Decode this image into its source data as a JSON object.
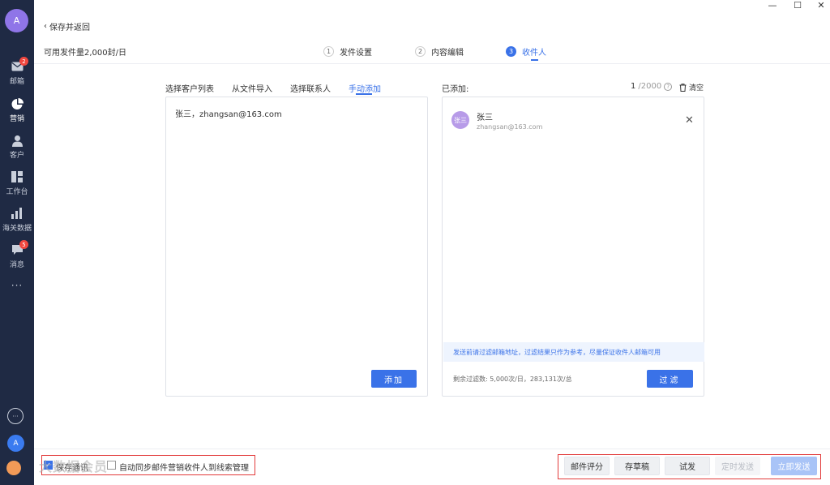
{
  "sidebar": {
    "avatar_letter": "A",
    "items": [
      {
        "label": "邮箱",
        "icon": "mail-icon",
        "badge": "2"
      },
      {
        "label": "营销",
        "icon": "pie-chart-icon",
        "badge": ""
      },
      {
        "label": "客户",
        "icon": "person-icon",
        "badge": ""
      },
      {
        "label": "工作台",
        "icon": "grid-icon",
        "badge": ""
      },
      {
        "label": "海关数据",
        "icon": "bar-chart-icon",
        "badge": ""
      },
      {
        "label": "消息",
        "icon": "chat-icon",
        "badge": "5"
      }
    ],
    "more": "···",
    "circle_btn": "···",
    "small_avatar_letter": "A"
  },
  "window": {
    "minimize": "—",
    "maximize": "☐",
    "close": "✕"
  },
  "header": {
    "back_label": "保存并返回",
    "quota_text": "可用发件量2,000封/日",
    "steps": [
      {
        "num": "1",
        "label": "发件设置"
      },
      {
        "num": "2",
        "label": "内容编辑"
      },
      {
        "num": "3",
        "label": "收件人"
      }
    ]
  },
  "tabs": [
    "选择客户列表",
    "从文件导入",
    "选择联系人",
    "手动添加"
  ],
  "left_panel": {
    "input_text": "张三，zhangsan@163.com",
    "add_button": "添加"
  },
  "right_panel": {
    "added_label": "已添加:",
    "count_current": "1",
    "count_total": "/2000",
    "clear_label": "清空",
    "recipient": {
      "avatar": "张三",
      "name": "张三",
      "email": "zhangsan@163.com"
    },
    "notice": "发送前请过滤邮箱地址，过滤结果只作为参考，尽量保证收件人邮箱可用",
    "remaining": "剩余过滤数: 5,000次/日，283,131次/总",
    "filter_button": "过滤"
  },
  "footer": {
    "checkbox1_label": "保存通讯",
    "checkbox2_label": "自动同步邮件营销收件人到线索管理",
    "buttons": [
      "邮件评分",
      "存草稿",
      "试发",
      "定时发送",
      "立即发送"
    ],
    "watermark": "大数据会员"
  },
  "colors": {
    "primary": "#3a72e8",
    "sidebar": "#1f2a44",
    "highlight": "#e23b3b"
  }
}
